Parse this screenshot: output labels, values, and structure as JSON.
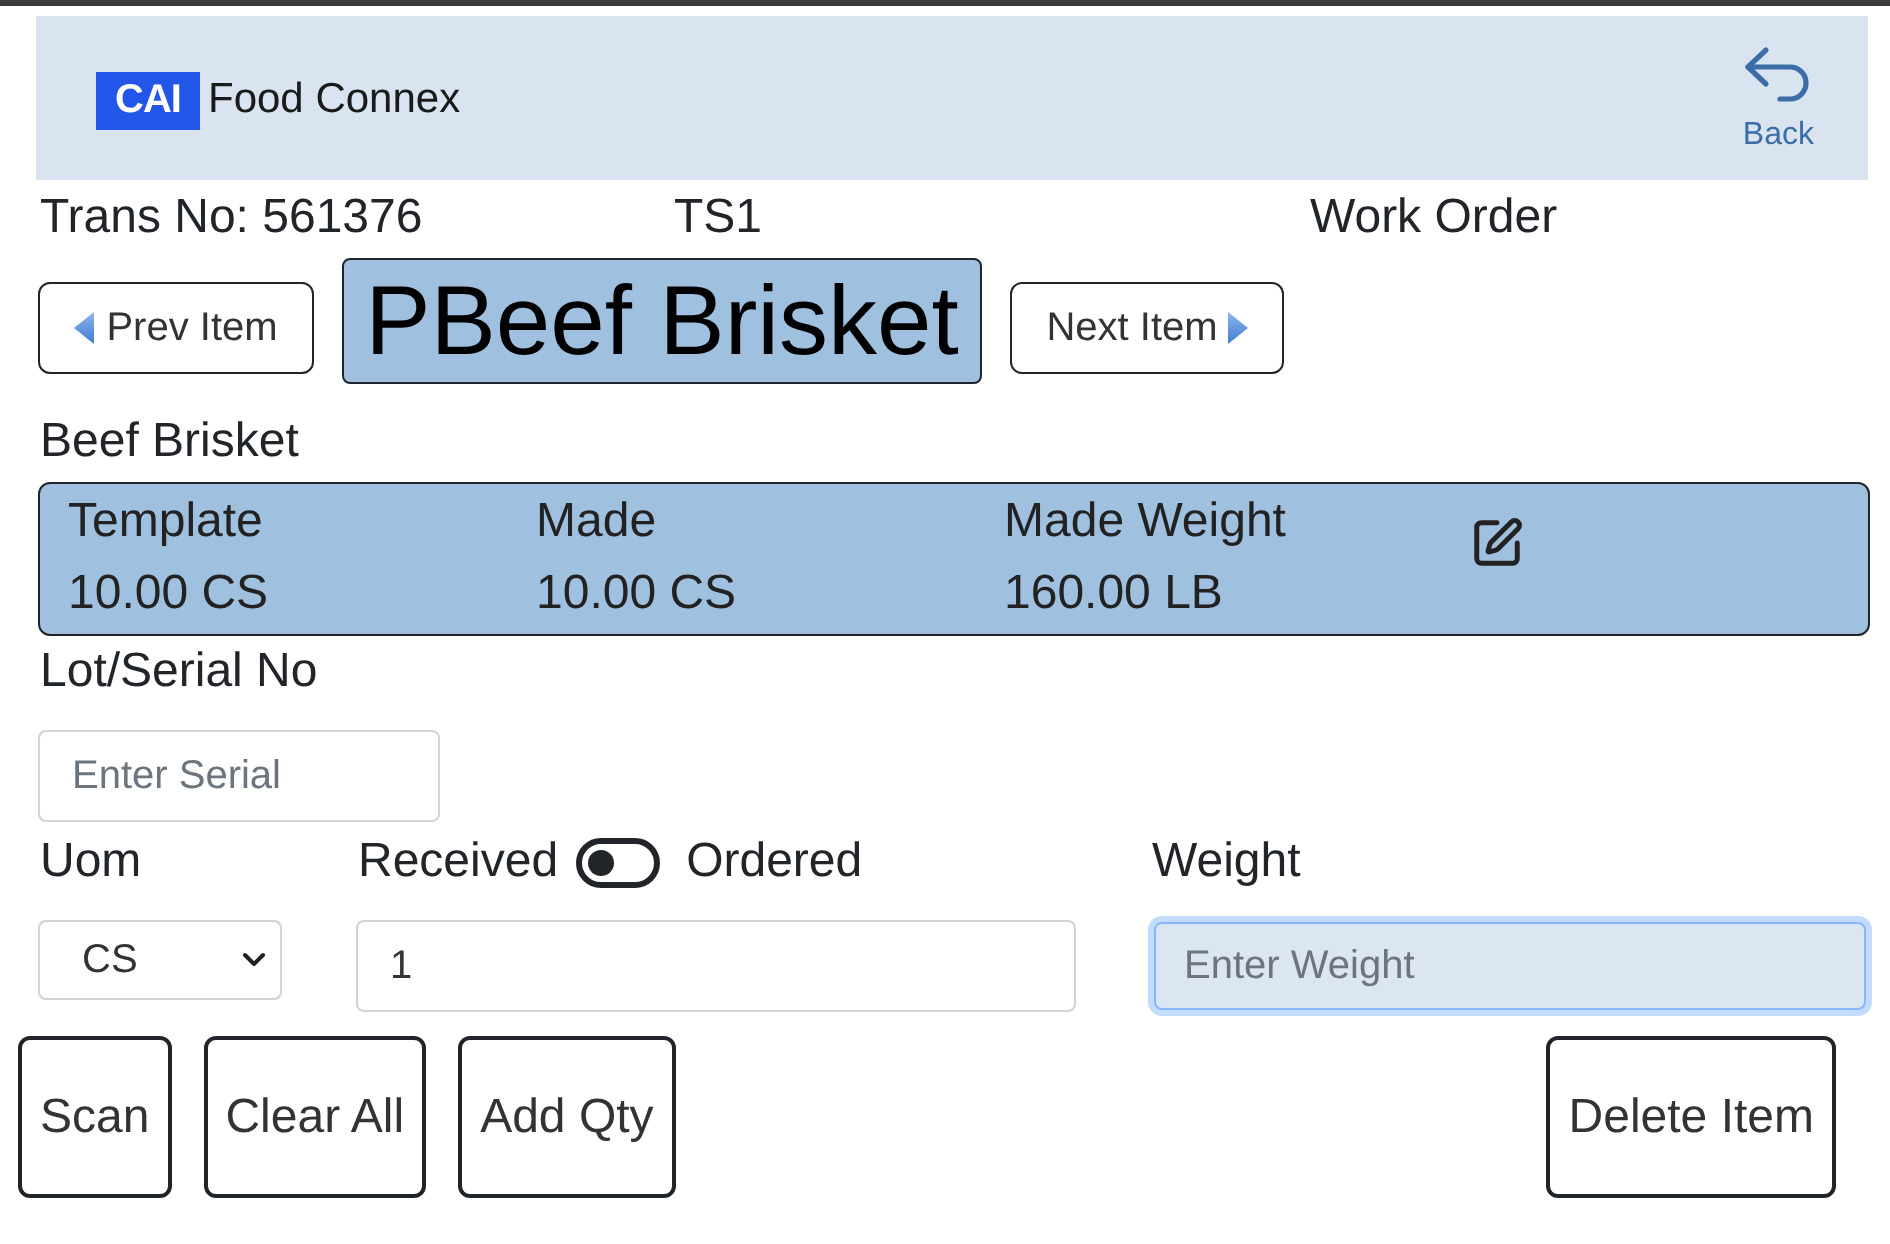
{
  "header": {
    "logo": {
      "mark": "CAI",
      "text": "Food Connex"
    },
    "back_button": {
      "label": "Back"
    }
  },
  "transaction": {
    "trans_no": "Trans No: 561376",
    "station": "TS1",
    "order_type": "Work Order"
  },
  "item_nav": {
    "prev": "Prev Item",
    "title": "PBeef Brisket",
    "next": "Next Item"
  },
  "item_name": "Beef Brisket",
  "summary": {
    "columns": [
      {
        "label": "Template",
        "value": "10.00 CS"
      },
      {
        "label": "Made",
        "value": "10.00 CS"
      },
      {
        "label": "Made Weight",
        "value": "160.00 LB"
      }
    ]
  },
  "lot_serial": {
    "label": "Lot/Serial No",
    "placeholder": "Enter Serial"
  },
  "uom": {
    "label": "Uom",
    "value": "CS"
  },
  "quantity": {
    "toggle": {
      "left_label": "Received",
      "right_label": "Ordered",
      "on": false
    },
    "value": "1"
  },
  "weight": {
    "label": "Weight",
    "placeholder": "Enter Weight",
    "focused": true
  },
  "actions": [
    {
      "label": "Scan"
    },
    {
      "label": "Clear All"
    },
    {
      "label": "Add Qty"
    }
  ],
  "delete_button": {
    "label": "Delete Item"
  }
}
